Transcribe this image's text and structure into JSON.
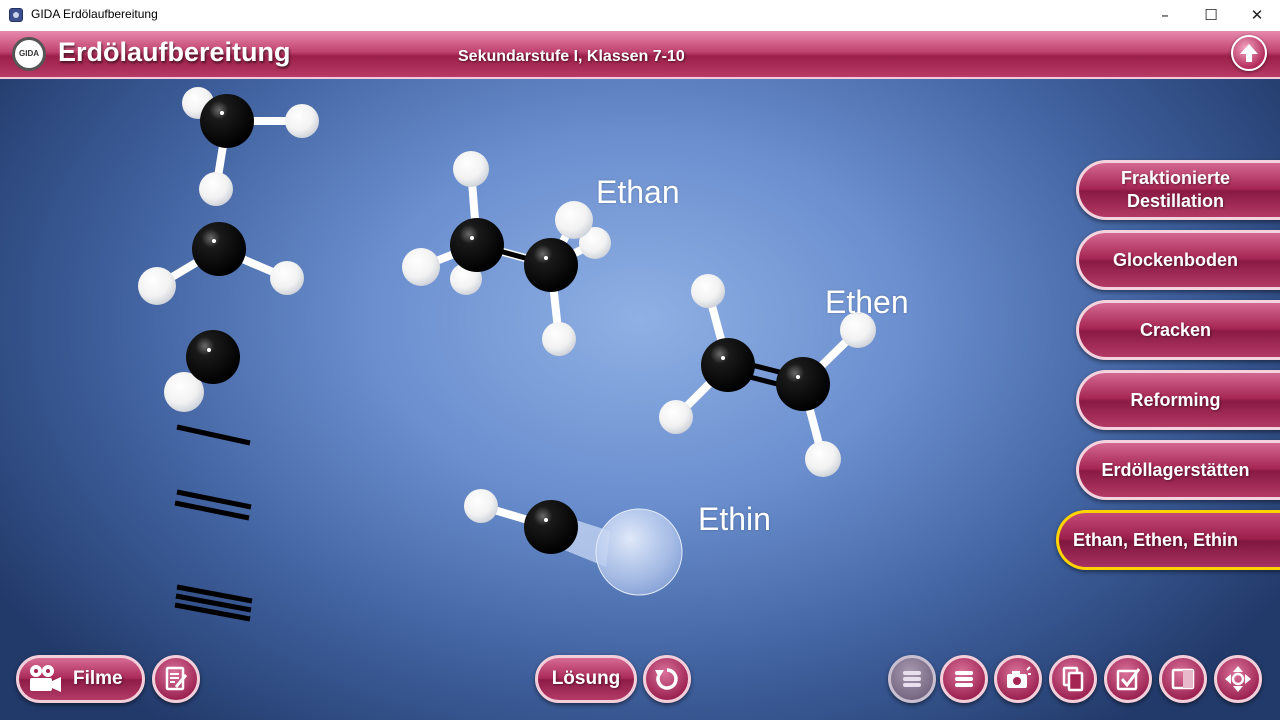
{
  "window": {
    "title": "GIDA Erdölaufbereitung",
    "controls": [
      "minimize",
      "maximize",
      "close"
    ]
  },
  "header": {
    "logo_text": "GIDA",
    "title": "Erdölaufbereitung",
    "subtitle": "Sekundarstufe I, Klassen 7-10",
    "up_button_icon": "arrow-up-icon"
  },
  "stage": {
    "labels": {
      "ethan": "Ethan",
      "ethen": "Ethen",
      "ethin": "Ethin"
    }
  },
  "menu": {
    "items": [
      {
        "label": "Fraktionierte Destillation",
        "active": false
      },
      {
        "label": "Glockenboden",
        "active": false
      },
      {
        "label": "Cracken",
        "active": false
      },
      {
        "label": "Reforming",
        "active": false
      },
      {
        "label": "Erdöllagerstätten",
        "active": false
      },
      {
        "label": "Ethan, Ethen, Ethin",
        "active": true
      }
    ]
  },
  "toolbar": {
    "films_label": "Filme",
    "solution_label": "Lösung",
    "icons": [
      "film-camera-icon",
      "notepad-icon",
      "reset-icon",
      "list-icon",
      "list-icon",
      "camera-icon",
      "copy-icon",
      "checkbox-icon",
      "window-icon",
      "navigate-icon"
    ]
  },
  "colors": {
    "accent": "#a52552",
    "active_border": "#ffd400",
    "stage_center": "#8fb0e4",
    "stage_edge": "#223a6a"
  }
}
